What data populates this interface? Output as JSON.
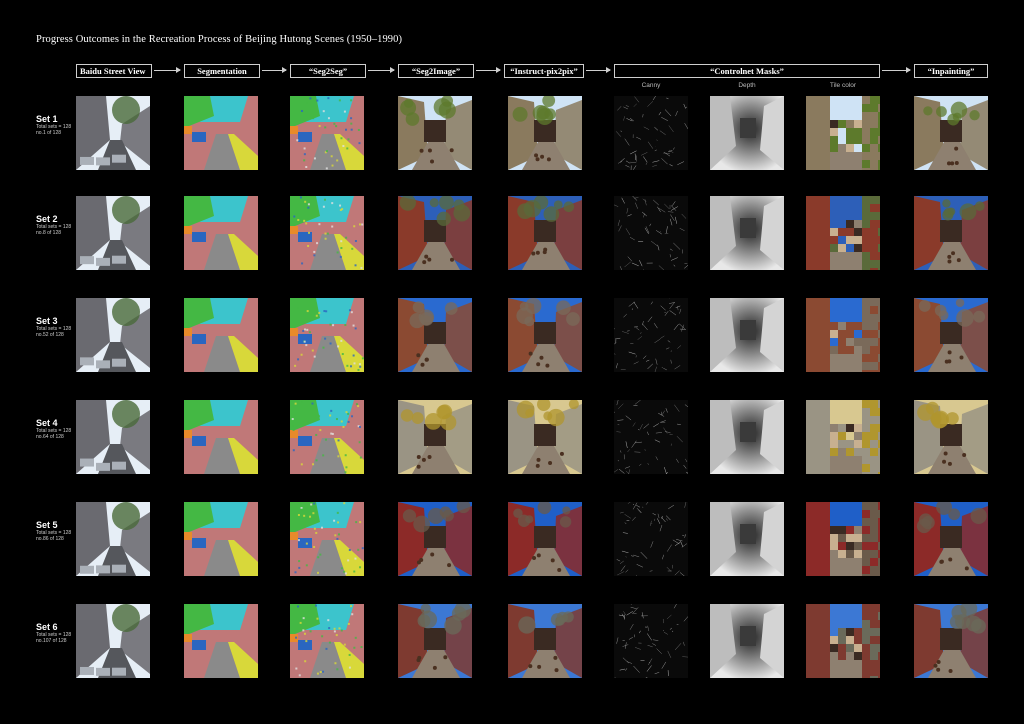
{
  "title": "Progress Outcomes in the Recreation Process of Beijing Hutong Scenes (1950–1990)",
  "columns": [
    {
      "label": "Baidu Street View",
      "kind": "photo"
    },
    {
      "label": "Segmentation",
      "kind": "seg"
    },
    {
      "label": "“Seg2Seg”",
      "kind": "seg2"
    },
    {
      "label": "“Seg2Image”",
      "kind": "render"
    },
    {
      "label": "“Instruct-pix2pix”",
      "kind": "render"
    },
    {
      "label": "Canny",
      "kind": "canny"
    },
    {
      "label": "Depth",
      "kind": "depth"
    },
    {
      "label": "Tile color",
      "kind": "tile"
    },
    {
      "label": "“Inpainting”",
      "kind": "render"
    }
  ],
  "controlnet_label": "“Controlnet Masks”",
  "sets": [
    {
      "name": "Set 1",
      "total": "Total sets = 128",
      "index": "no.1 of 128",
      "sky": "#cfe3f5",
      "wall": "#8a7a5e",
      "tree": "#5d7a2c"
    },
    {
      "name": "Set 2",
      "total": "Total sets = 128",
      "index": "no.8 of 128",
      "sky": "#2d5fb8",
      "wall": "#8a3a2a",
      "tree": "#5a6a3a"
    },
    {
      "name": "Set 3",
      "total": "Total sets = 128",
      "index": "no.52 of 128",
      "sky": "#2a6ad0",
      "wall": "#8b4a32",
      "tree": "#7a6a5a"
    },
    {
      "name": "Set 4",
      "total": "Total sets = 128",
      "index": "no.64 of 128",
      "sky": "#d8c890",
      "wall": "#9a9484",
      "tree": "#b0962e"
    },
    {
      "name": "Set 5",
      "total": "Total sets = 128",
      "index": "no.86 of 128",
      "sky": "#1f5fc8",
      "wall": "#8c2a28",
      "tree": "#6a5a4a"
    },
    {
      "name": "Set 6",
      "total": "Total sets = 128",
      "index": "no.107 of 128",
      "sky": "#3c78d4",
      "wall": "#7e3a30",
      "tree": "#6a6a5a"
    }
  ],
  "seg_colors": {
    "sky": "#3cc4cc",
    "building": "#c07878",
    "tree": "#44b844",
    "road": "#8a8a8a",
    "car": "#2a66c0",
    "sidewalk": "#d8d83a",
    "person": "#e88a2a",
    "fence": "#e0e0e0"
  }
}
